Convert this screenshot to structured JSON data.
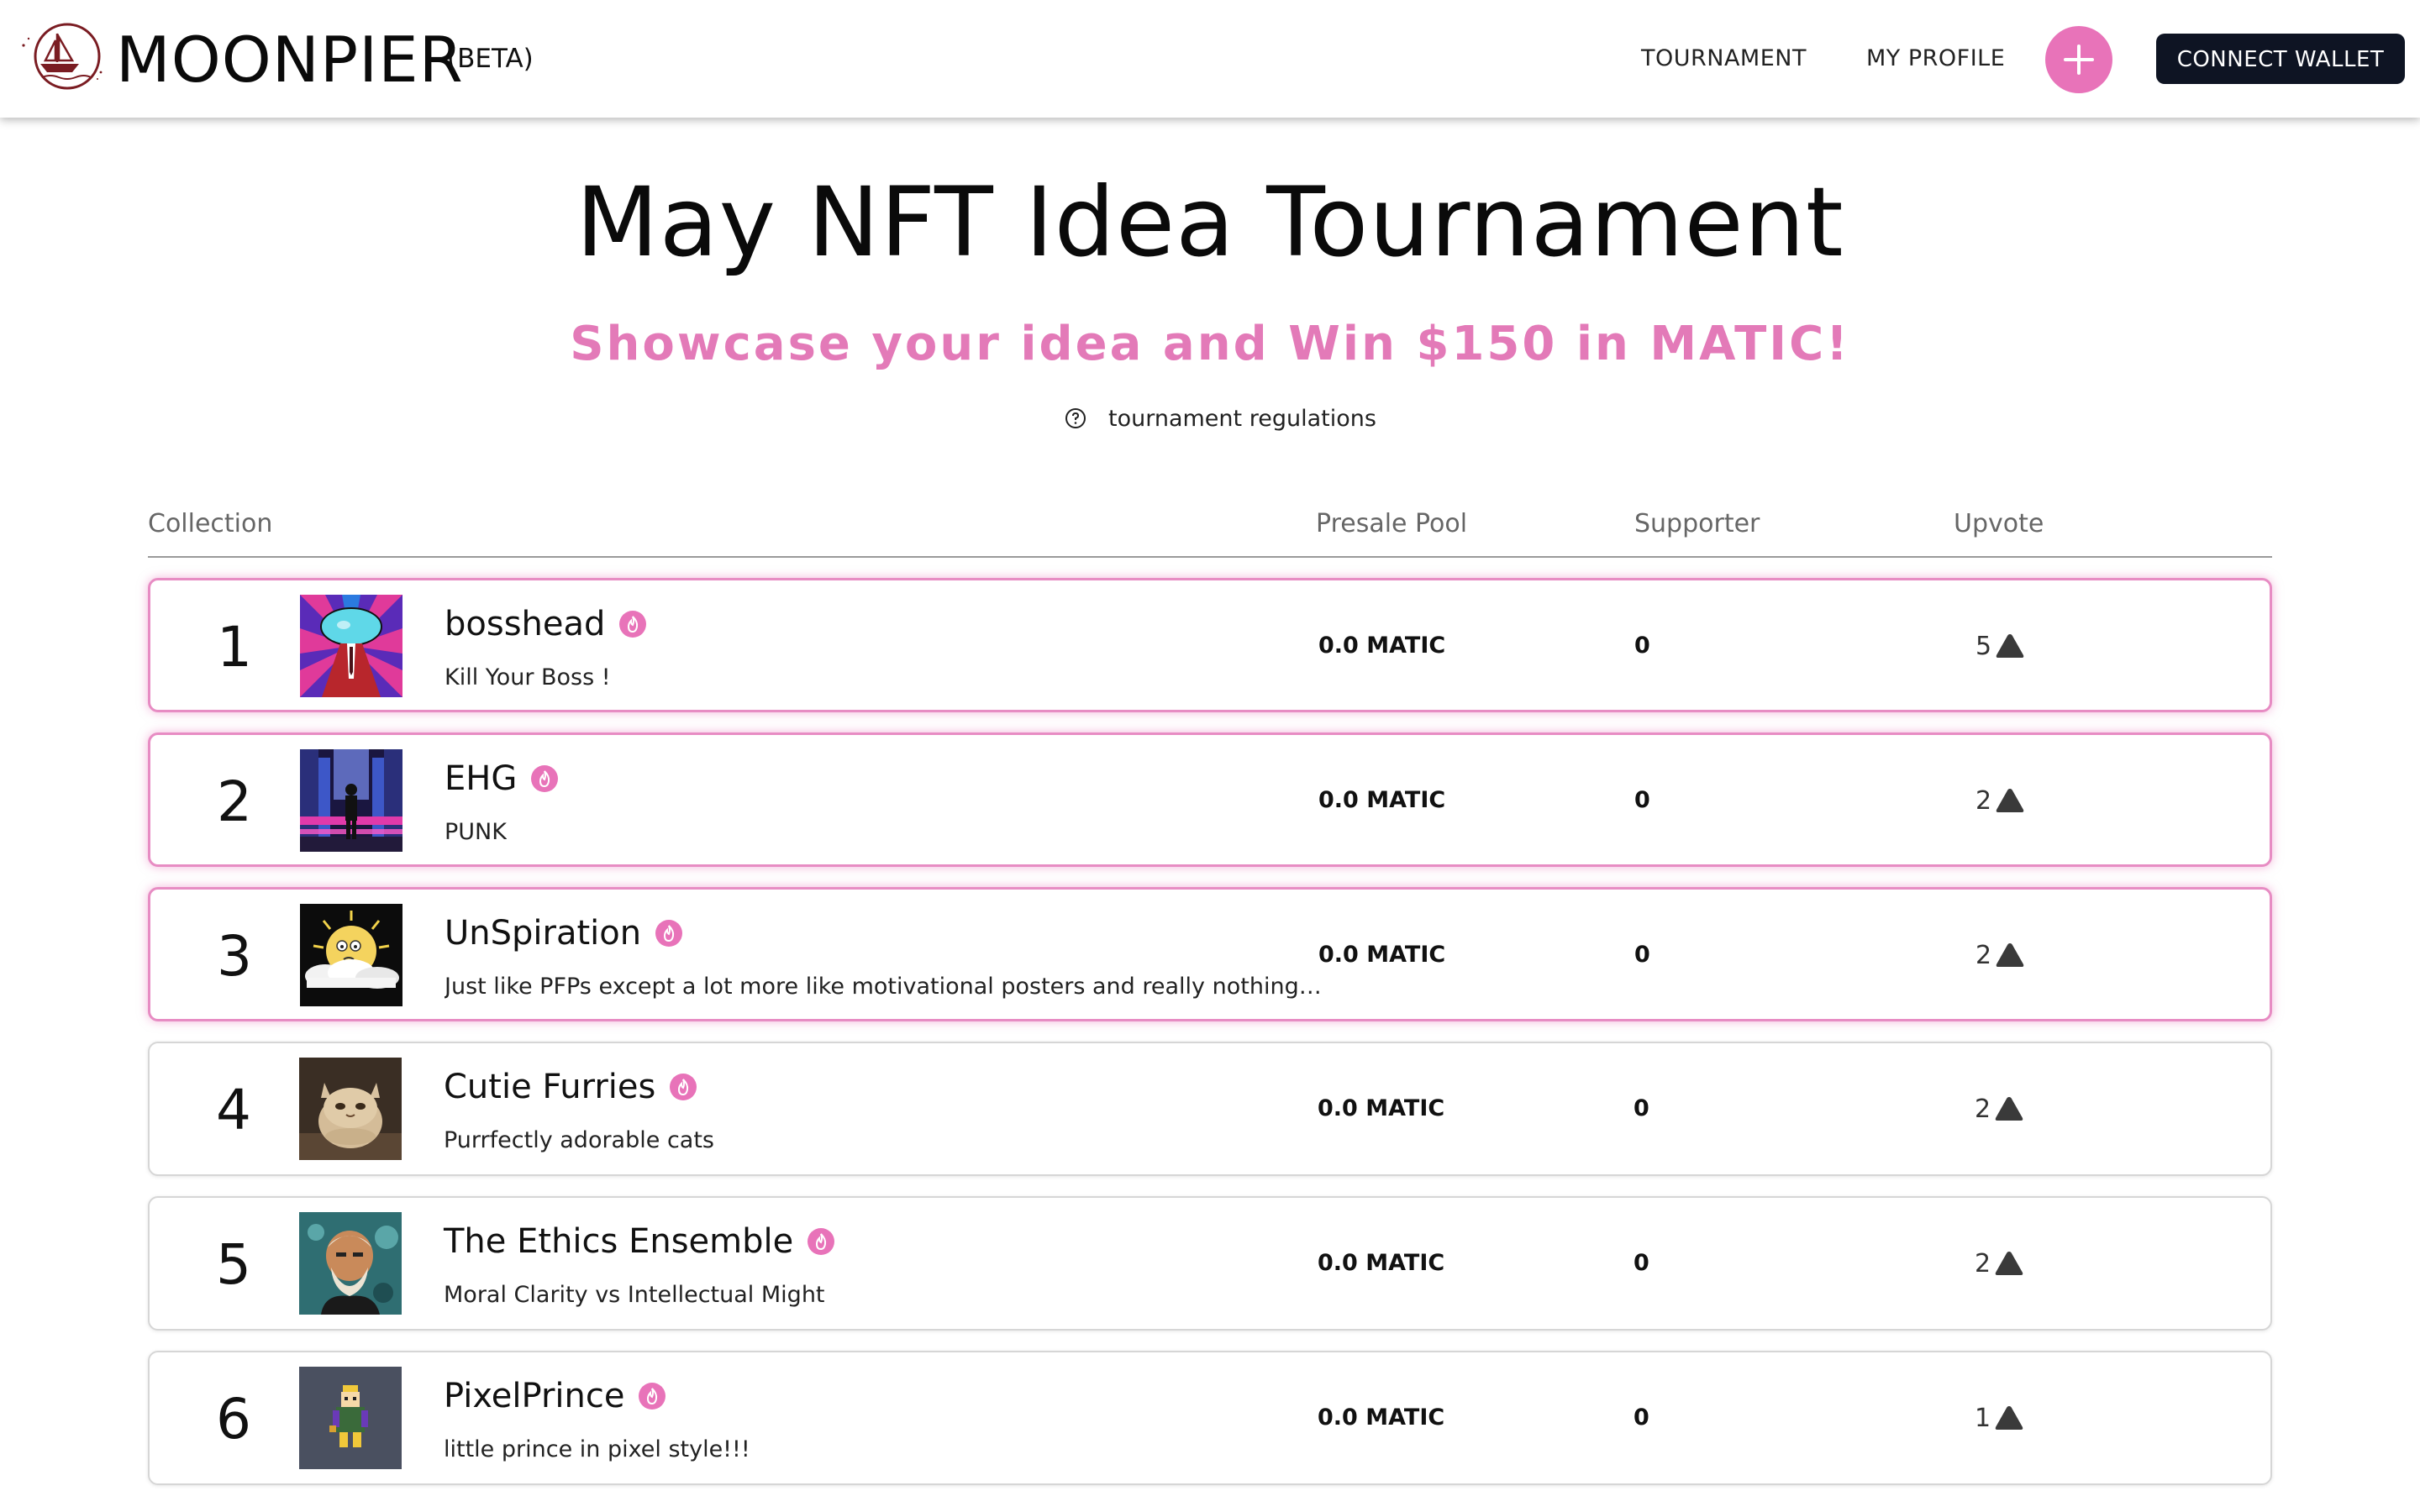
{
  "header": {
    "brand": "MOONPIER",
    "beta": "(BETA)",
    "nav": [
      {
        "label": "TOURNAMENT"
      },
      {
        "label": "MY PROFILE"
      }
    ],
    "connect_label": "CONNECT WALLET",
    "accent": "#e873b9",
    "dark": "#0e1423"
  },
  "hero": {
    "title": "May NFT Idea Tournament",
    "subtitle": "Showcase your idea and Win $150 in MATIC!",
    "regulations": "tournament regulations",
    "subtitle_color": "#e37ab8"
  },
  "table": {
    "columns": {
      "collection": "Collection",
      "presale": "Presale Pool",
      "supporter": "Supporter",
      "upvote": "Upvote"
    },
    "rows": [
      {
        "rank": "1",
        "name": "bosshead",
        "desc": "Kill Your Boss !",
        "presale": "0.0 MATIC",
        "supporters": "0",
        "upvotes": "5",
        "featured": true,
        "thumb": "bosshead-art"
      },
      {
        "rank": "2",
        "name": "EHG",
        "desc": "PUNK",
        "presale": "0.0 MATIC",
        "supporters": "0",
        "upvotes": "2",
        "featured": true,
        "thumb": "cyber-city-art"
      },
      {
        "rank": "3",
        "name": "UnSpiration",
        "desc": "Just like PFPs except a lot more like motivational posters and really nothing…",
        "presale": "0.0 MATIC",
        "supporters": "0",
        "upvotes": "2",
        "featured": true,
        "thumb": "sun-cloud-art"
      },
      {
        "rank": "4",
        "name": "Cutie Furries",
        "desc": "Purrfectly adorable cats",
        "presale": "0.0 MATIC",
        "supporters": "0",
        "upvotes": "2",
        "featured": false,
        "thumb": "fluffy-cat-art"
      },
      {
        "rank": "5",
        "name": "The Ethics Ensemble",
        "desc": "Moral Clarity vs Intellectual Might",
        "presale": "0.0 MATIC",
        "supporters": "0",
        "upvotes": "2",
        "featured": false,
        "thumb": "philosopher-art"
      },
      {
        "rank": "6",
        "name": "PixelPrince",
        "desc": "little prince in pixel style!!!",
        "presale": "0.0 MATIC",
        "supporters": "0",
        "upvotes": "1",
        "featured": false,
        "thumb": "pixel-prince-art"
      }
    ]
  }
}
